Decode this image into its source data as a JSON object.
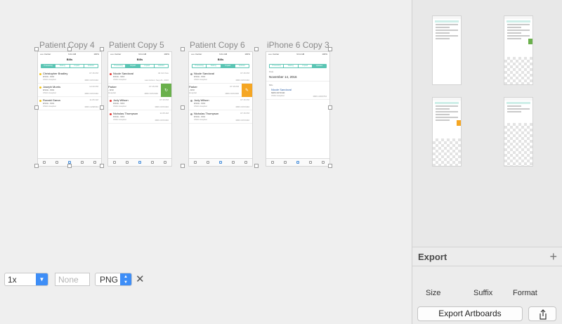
{
  "canvas": {
    "artboards": [
      {
        "label": "Patient Copy 4",
        "status_left": "••••• Carrier",
        "status_time": "9:41 AM",
        "status_right": "100%",
        "title": "Bills",
        "tabs": [
          "Processing",
          "Waiting",
          "Unpaid",
          "Updates"
        ],
        "active_tab": 0,
        "rows": [
          {
            "name": "Christopher Bradley",
            "sub": "9/14A - 9/13",
            "hosp": "CMH Hospital",
            "time": "07:15 PM",
            "mrn": "MRN 0072340",
            "dot": "#f5c518"
          },
          {
            "name": "Joseph Morris",
            "sub": "9/14A - 9/13",
            "hosp": "CMH Hospital",
            "time": "12:20 PM",
            "mrn": "MRN 0072340",
            "dot": "#f5c518"
          },
          {
            "name": "Ronald Garza",
            "sub": "9/14A - 9/13",
            "hosp": "CMH Hospital",
            "time": "11:05 AM",
            "mrn": "MRN 2238334",
            "dot": "#f5c518"
          }
        ]
      },
      {
        "label": "Patient Copy 5",
        "status_left": "••••• Carrier",
        "status_time": "9:41 AM",
        "status_right": "100%",
        "title": "Bills",
        "tabs": [
          "Processing",
          "Unpaid",
          "Unpaid",
          "Updates"
        ],
        "active_tab": 1,
        "rows": [
          {
            "name": "Nicole Sandoval",
            "sub": "9/14A - 9/13",
            "hosp": "CMH Hospital",
            "time": "34 Oct Nov",
            "mrn": "Last Action: Sep 21, 2016",
            "dot": "#e53935"
          },
          {
            "name": "Parker",
            "sub": "- 9/13",
            "hosp": "Hospital",
            "time": "07:15 PM",
            "mrn": "MRN 0072340",
            "dot": "#e53935",
            "swipe": "#6ab04c",
            "swipe_icon": "↻"
          },
          {
            "name": "Judy Wilson",
            "sub": "9/14A - 9/13",
            "hosp": "CMH Hospital",
            "time": "07:15 PM",
            "mrn": "MRN 0072340",
            "dot": "#e53935"
          },
          {
            "name": "Nicholas Thompson",
            "sub": "9/14A - 9/13",
            "hosp": "CMH Hospital",
            "time": "11:05 AM",
            "mrn": "MRN 0072340",
            "dot": "#e53935"
          }
        ]
      },
      {
        "label": "Patient Copy 6",
        "status_left": "••••• Carrier",
        "status_time": "9:41 AM",
        "status_right": "100%",
        "title": "Bills",
        "tabs": [
          "Processing",
          "Waiting",
          "Unpaid",
          "Updates"
        ],
        "active_tab": 2,
        "rows": [
          {
            "name": "Nicole Sandoval",
            "sub": "9/14A - 9/13",
            "hosp": "CMH Hospital",
            "time": "07:15 PM",
            "mrn": "MRN 0072340",
            "dot": "#9e9e9e"
          },
          {
            "name": "Parker",
            "sub": "- 9/13",
            "hosp": "Hospital",
            "time": "07:15 PM",
            "mrn": "MRN 0072340",
            "dot": "#9e9e9e",
            "swipe": "#f5a623",
            "swipe_icon": "✎"
          },
          {
            "name": "Judy Wilson",
            "sub": "9/14A - 9/13",
            "hosp": "CMH Hospital",
            "time": "07:15 PM",
            "mrn": "MRN 0072340",
            "dot": "#9e9e9e"
          },
          {
            "name": "Nicholas Thompson",
            "sub": "9/14A - 9/13",
            "hosp": "CMH Hospital",
            "time": "07:15 PM",
            "mrn": "MRN 0072340",
            "dot": "#9e9e9e"
          }
        ]
      },
      {
        "label": "iPhone 6 Copy 3",
        "status_left": "••••• Carrier",
        "status_time": "9:41 AM",
        "status_right": "100%",
        "title": "",
        "tabs": [
          "Processing",
          "Waiting",
          "Unpaid",
          "Updates"
        ],
        "active_tab": 3,
        "date_label": "Date",
        "date_value": "November 14, 2016",
        "bills_label": "Bills",
        "rows": [
          {
            "name": "Nicole Sandoval",
            "sub": "MRN 0072340",
            "hosp": "CMH Hospital",
            "time": "",
            "mrn": "MRN 2203794",
            "dot": ""
          }
        ]
      }
    ]
  },
  "panel": {
    "export": {
      "title": "Export",
      "add_icon": "+",
      "scale_value": "1x",
      "scale_caption": "Size",
      "suffix_placeholder": "None",
      "suffix_caption": "Suffix",
      "format_value": "PNG",
      "format_caption": "Format",
      "remove_icon": "✕",
      "export_button": "Export Artboards"
    }
  },
  "colors": {
    "accent_teal": "#5bc5b4",
    "select_blue": "#3e8ef7",
    "swipe_green": "#6ab04c",
    "swipe_orange": "#f5a623"
  }
}
